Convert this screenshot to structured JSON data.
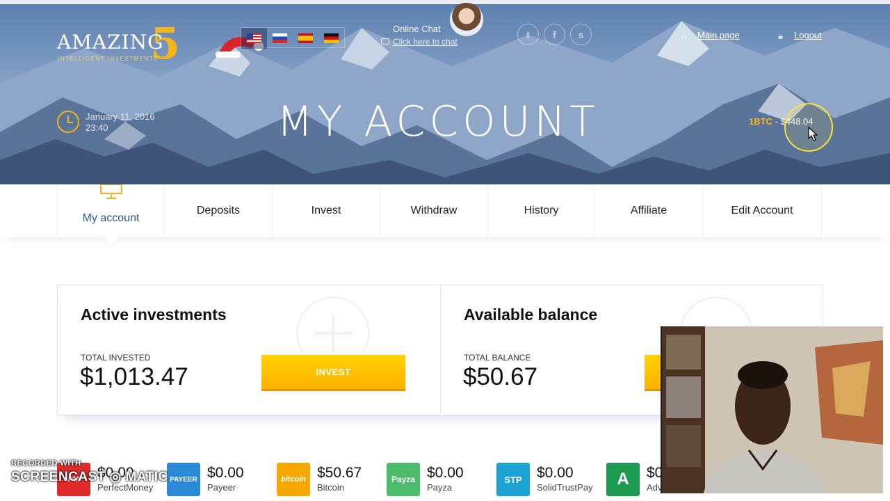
{
  "header": {
    "logo_text": "AMAZING",
    "logo_number": "5",
    "logo_tagline": "INTELLIGENT INVESTMENTS",
    "languages": [
      {
        "code": "en",
        "icon": "flag-us-icon",
        "active": true
      },
      {
        "code": "ru",
        "icon": "flag-ru-icon",
        "active": false
      },
      {
        "code": "es",
        "icon": "flag-es-icon",
        "active": false
      },
      {
        "code": "de",
        "icon": "flag-de-icon",
        "active": false
      }
    ],
    "chat": {
      "label": "Online Chat",
      "link": "Click here to chat"
    },
    "socials": [
      {
        "name": "twitter",
        "glyph": "t"
      },
      {
        "name": "facebook",
        "glyph": "f"
      },
      {
        "name": "skype",
        "glyph": "s"
      }
    ],
    "main_page_label": "Main page",
    "logout_label": "Logout"
  },
  "hero": {
    "date": "January 11, 2016",
    "time": "23:40",
    "title": "MY ACCOUNT",
    "btc_symbol": "1BTC",
    "btc_rate": " - $448.04"
  },
  "nav": {
    "tabs": [
      "My account",
      "Deposits",
      "Invest",
      "Withdraw",
      "History",
      "Affiliate",
      "Edit Account"
    ],
    "active_index": 0
  },
  "cards": {
    "active": {
      "title": "Active investments",
      "label": "TOTAL INVESTED",
      "value": "$1,013.47",
      "button": "INVEST"
    },
    "balance": {
      "title": "Available balance",
      "label": "TOTAL BALANCE",
      "value": "$50.67"
    }
  },
  "wallets": [
    {
      "amount": "$0.00",
      "name": "PerfectMoney",
      "icon_text": "PM",
      "color": "#e02b2b"
    },
    {
      "amount": "$0.00",
      "name": "Payeer",
      "icon_text": "PAYEER",
      "color": "#2b8ad8"
    },
    {
      "amount": "$50.67",
      "name": "Bitcoin",
      "icon_text": "bitcoin",
      "color": "#f5a800"
    },
    {
      "amount": "$0.00",
      "name": "Payza",
      "icon_text": "Payza",
      "color": "#4cbc6b"
    },
    {
      "amount": "$0.00",
      "name": "SolidTrustPay",
      "icon_text": "STP",
      "color": "#1ba3d4"
    },
    {
      "amount": "$0",
      "name": "Adv",
      "icon_text": "A",
      "color": "#1f9a53"
    }
  ],
  "watermark": {
    "line1": "RECORDED WITH",
    "line2": "SCREENCAST",
    "line3": "MATIC"
  },
  "colors": {
    "accent": "#f3b51a",
    "nav_active": "#2b5a8e",
    "button": "#ffc000"
  }
}
